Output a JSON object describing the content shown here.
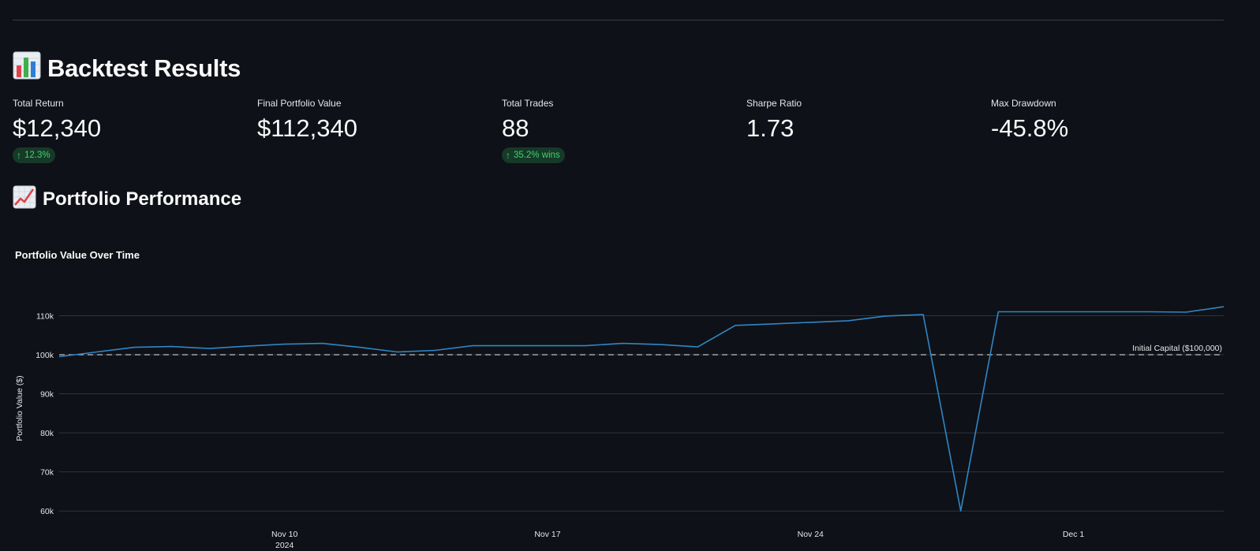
{
  "results": {
    "heading": "Backtest Results",
    "heading_icon": "bar-chart-emoji-icon"
  },
  "metrics": [
    {
      "label": "Total Return",
      "value": "$12,340",
      "delta": "12.3%",
      "delta_color": "#3dd56d"
    },
    {
      "label": "Final Portfolio Value",
      "value": "$112,340"
    },
    {
      "label": "Total Trades",
      "value": "88",
      "delta": "35.2% wins",
      "delta_color": "#3dd56d"
    },
    {
      "label": "Sharpe Ratio",
      "value": "1.73"
    },
    {
      "label": "Max Drawdown",
      "value": "-45.8%"
    }
  ],
  "performance": {
    "heading": "Portfolio Performance",
    "heading_icon": "chart-increasing-emoji-icon"
  },
  "chart_data": {
    "type": "line",
    "title": "Portfolio Value Over Time",
    "xlabel": "",
    "ylabel": "Portfolio Value ($)",
    "x_tick_labels": [
      "Nov 10",
      "Nov 17",
      "Nov 24",
      "Dec 1"
    ],
    "x_tick_sublabel": "2024",
    "y_tick_labels": [
      "60k",
      "70k",
      "80k",
      "90k",
      "100k",
      "110k"
    ],
    "ylim": [
      60000,
      112500
    ],
    "grid": true,
    "line_color": "#2f86c6",
    "reference_line": {
      "label": "Initial Capital ($100,000)",
      "value": 100000,
      "color": "#c0c0c0"
    },
    "series": [
      {
        "x": [
          "2024-11-04",
          "2024-11-05",
          "2024-11-06",
          "2024-11-07",
          "2024-11-08",
          "2024-11-09",
          "2024-11-10",
          "2024-11-11",
          "2024-11-12",
          "2024-11-13",
          "2024-11-14",
          "2024-11-15",
          "2024-11-16",
          "2024-11-17",
          "2024-11-18",
          "2024-11-19",
          "2024-11-20",
          "2024-11-21",
          "2024-11-22",
          "2024-11-23",
          "2024-11-24",
          "2024-11-25",
          "2024-11-26",
          "2024-11-27",
          "2024-11-28",
          "2024-11-29",
          "2024-11-30",
          "2024-12-01",
          "2024-12-02",
          "2024-12-03",
          "2024-12-04",
          "2024-12-05"
        ],
        "values": [
          99500,
          100700,
          101900,
          102100,
          101600,
          102200,
          102700,
          102900,
          101900,
          100700,
          101100,
          102300,
          102300,
          102300,
          102300,
          102900,
          102600,
          102000,
          107500,
          107900,
          108300,
          108700,
          109900,
          110300,
          60000,
          111000,
          111000,
          111000,
          111000,
          111000,
          110900,
          112300
        ]
      }
    ]
  }
}
